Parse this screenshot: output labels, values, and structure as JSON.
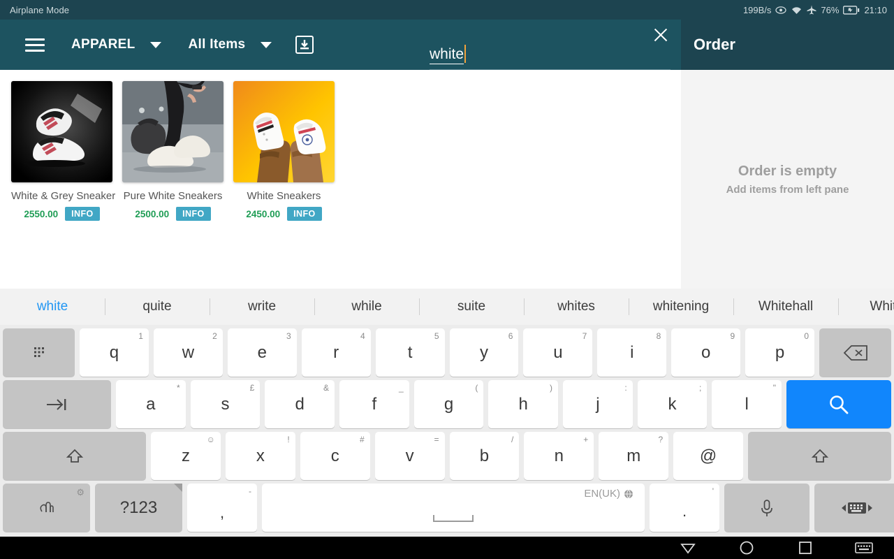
{
  "statusbar": {
    "left_text": "Airplane Mode",
    "net_speed": "199B/s",
    "battery": "76%",
    "clock": "21:10",
    "icons": [
      "eye-icon",
      "wifi-icon",
      "airplane-icon",
      "battery-icon"
    ]
  },
  "header": {
    "menu_icon": "hamburger-icon",
    "category": "APPAREL",
    "filter": "All Items",
    "download_icon": "download-icon"
  },
  "search": {
    "value": "white",
    "clear_icon": "close-icon"
  },
  "order": {
    "title": "Order",
    "empty_title": "Order is empty",
    "empty_sub": "Add items from left pane"
  },
  "products": [
    {
      "name": "White & Grey Sneaker",
      "price": "2550.00",
      "info_label": "INFO"
    },
    {
      "name": "Pure White Sneakers",
      "price": "2500.00",
      "info_label": "INFO"
    },
    {
      "name": "White Sneakers",
      "price": "2450.00",
      "info_label": "INFO"
    }
  ],
  "keyboard": {
    "suggestions": [
      "white",
      "quite",
      "write",
      "while",
      "suite",
      "whites",
      "whitening",
      "Whitehall",
      "Whiteh"
    ],
    "active_suggestion_index": 0,
    "row1": [
      {
        "main": "q",
        "sub": "1"
      },
      {
        "main": "w",
        "sub": "2"
      },
      {
        "main": "e",
        "sub": "3"
      },
      {
        "main": "r",
        "sub": "4"
      },
      {
        "main": "t",
        "sub": "5"
      },
      {
        "main": "y",
        "sub": "6"
      },
      {
        "main": "u",
        "sub": "7"
      },
      {
        "main": "i",
        "sub": "8"
      },
      {
        "main": "o",
        "sub": "9"
      },
      {
        "main": "p",
        "sub": "0"
      }
    ],
    "row2": [
      {
        "main": "a",
        "sub": "*"
      },
      {
        "main": "s",
        "sub": "£"
      },
      {
        "main": "d",
        "sub": "&"
      },
      {
        "main": "f",
        "sub": "_"
      },
      {
        "main": "g",
        "sub": "("
      },
      {
        "main": "h",
        "sub": ")"
      },
      {
        "main": "j",
        "sub": ":"
      },
      {
        "main": "k",
        "sub": ";"
      },
      {
        "main": "l",
        "sub": "\""
      }
    ],
    "row3": [
      {
        "main": "z",
        "sub": "☺"
      },
      {
        "main": "x",
        "sub": "!"
      },
      {
        "main": "c",
        "sub": "#"
      },
      {
        "main": "v",
        "sub": "="
      },
      {
        "main": "b",
        "sub": "/"
      },
      {
        "main": "n",
        "sub": "+"
      },
      {
        "main": "m",
        "sub": "?"
      },
      {
        "main": "@",
        "sub": ""
      }
    ],
    "symbols_label": "?123",
    "comma": ",",
    "comma_sub": "-",
    "period": ".",
    "period_sub": "'",
    "space_language": "EN(UK)",
    "grid_key_icon": "grid-icon",
    "tab_key_icon": "tab-icon",
    "shift_icon": "shift-icon",
    "backspace_icon": "backspace-icon",
    "enter_icon": "search-icon",
    "handwriting_icon": "handwriting-icon",
    "mic_icon": "microphone-icon",
    "resize_icon": "keyboard-resize-icon",
    "globe_icon": "globe-icon"
  },
  "navbar": {
    "back_icon": "back-triangle-icon",
    "home_icon": "home-circle-icon",
    "recents_icon": "recents-square-icon",
    "keyboard_icon": "keyboard-icon"
  },
  "colors": {
    "appbar": "#1d5360",
    "statusbar": "#1d4450",
    "accent_price": "#1f9d55",
    "info_btn": "#41a7c5",
    "enter_key": "#1186fc",
    "suggestion_active": "#2196f3",
    "cursor": "#f2a33c"
  }
}
